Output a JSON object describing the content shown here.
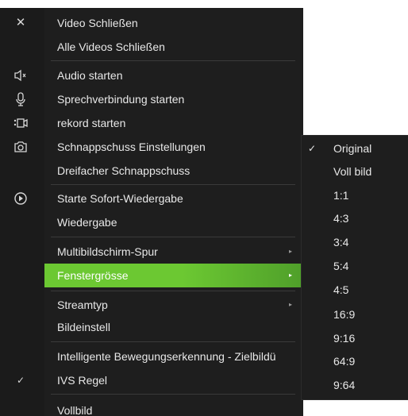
{
  "menu": {
    "items": [
      {
        "label": "Video Schließen",
        "icon": "close-icon",
        "glyph": "✕"
      },
      {
        "label": "Alle Videos Schließen"
      },
      {
        "label": "Audio starten",
        "icon": "speaker-icon"
      },
      {
        "label": "Sprechverbindung starten",
        "icon": "microphone-icon"
      },
      {
        "label": "rekord starten",
        "icon": "record-icon"
      },
      {
        "label": "Schnappschuss Einstellungen",
        "icon": "camera-icon"
      },
      {
        "label": "Dreifacher Schnappschuss"
      },
      {
        "label": "Starte Sofort-Wiedergabe",
        "icon": "play-icon"
      },
      {
        "label": "Wiedergabe"
      },
      {
        "label": "Multibildschirm-Spur",
        "submenu": true
      },
      {
        "label": "Fenstergrösse",
        "submenu": true,
        "highlighted": true
      },
      {
        "label": "Streamtyp",
        "submenu": true
      },
      {
        "label": "Bildeinstell"
      },
      {
        "label": "Intelligente Bewegungserkennung - Zielbildü"
      },
      {
        "label": "IVS Regel",
        "checked": true
      },
      {
        "label": "Vollbild"
      }
    ],
    "arrow_glyph": "▸",
    "check_glyph": "✓",
    "highlight_color": "#6cc832",
    "background_color": "#1e1e1e"
  },
  "submenu": {
    "title_item": "Fenstergrösse",
    "items": [
      {
        "label": "Original",
        "checked": true
      },
      {
        "label": "Voll bild"
      },
      {
        "label": "1:1"
      },
      {
        "label": "4:3"
      },
      {
        "label": "3:4"
      },
      {
        "label": "5:4"
      },
      {
        "label": "4:5"
      },
      {
        "label": "16:9"
      },
      {
        "label": "9:16"
      },
      {
        "label": "64:9"
      },
      {
        "label": "9:64"
      }
    ]
  }
}
